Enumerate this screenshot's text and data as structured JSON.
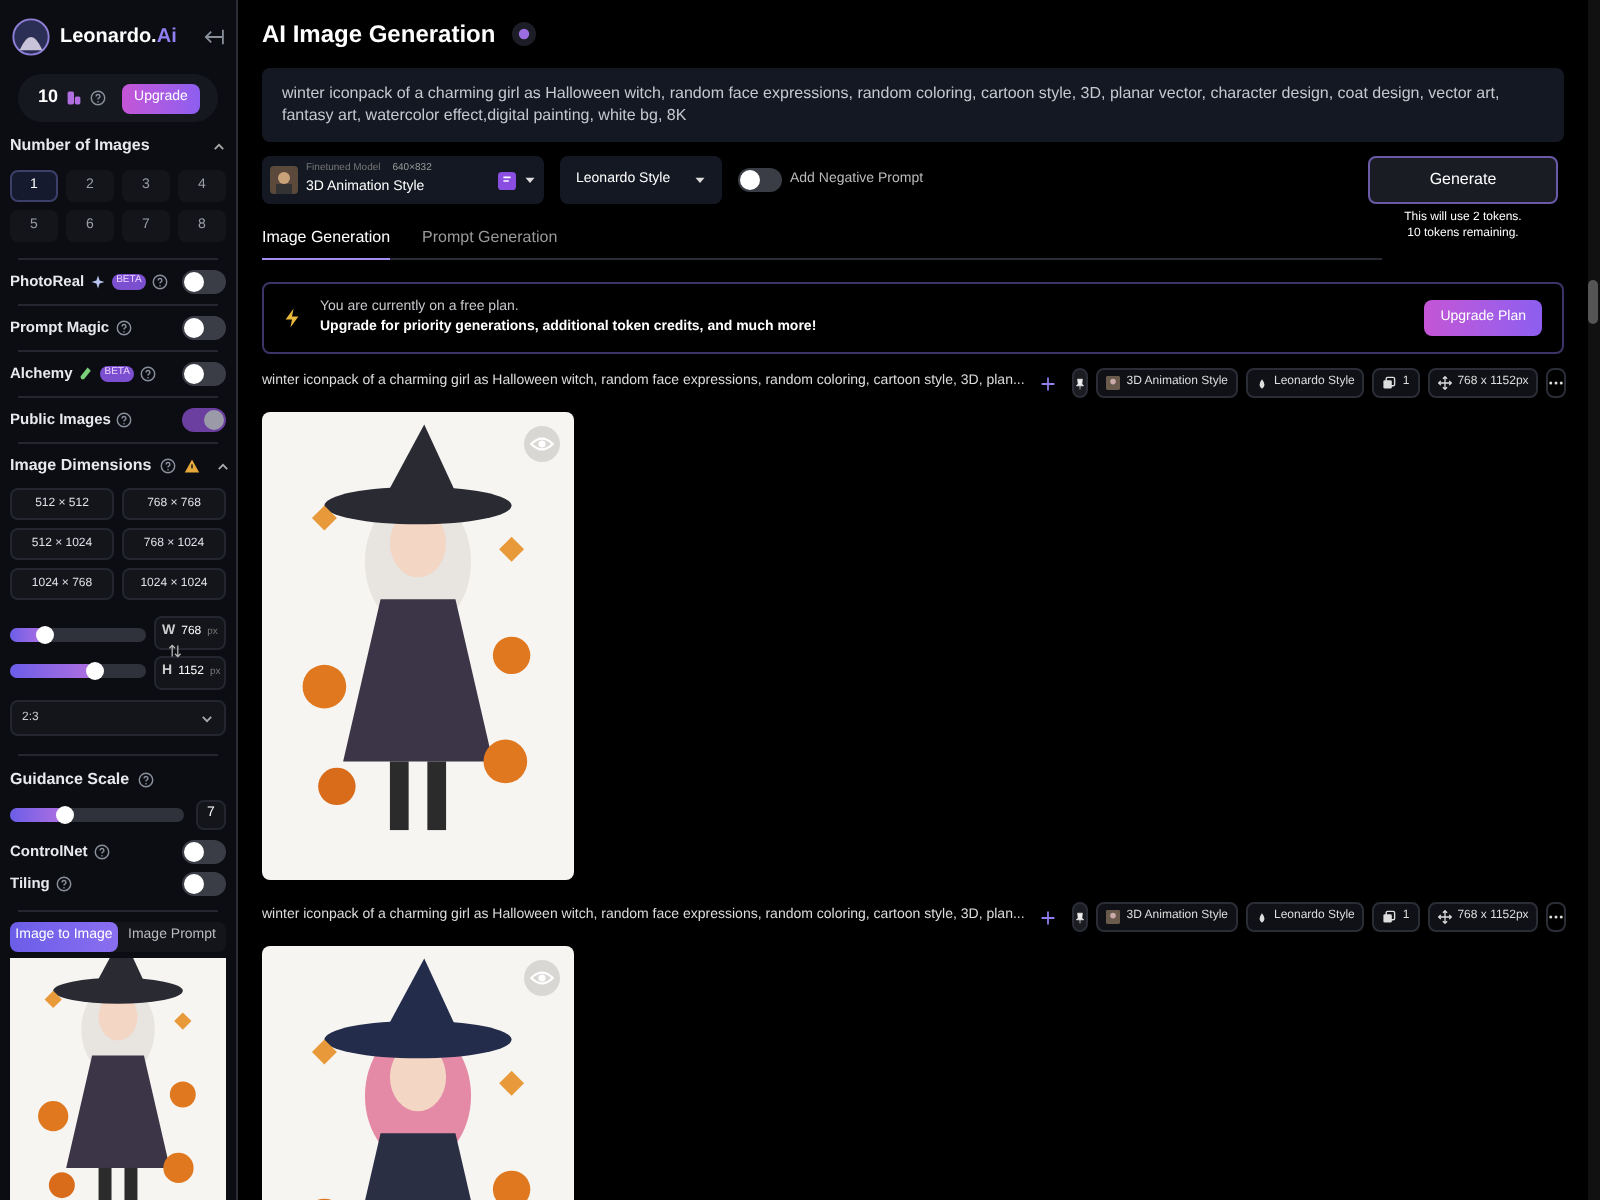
{
  "sidebar": {
    "brand": "Leonardo.",
    "brand_accent": "Ai",
    "tokens": "10",
    "upgrade": "Upgrade",
    "number_of_images": {
      "title": "Number of Images",
      "options": [
        {
          "label": "1",
          "selected": true
        },
        {
          "label": "2",
          "selected": false
        },
        {
          "label": "3",
          "selected": false
        },
        {
          "label": "4",
          "selected": false
        },
        {
          "label": "5",
          "selected": false
        },
        {
          "label": "6",
          "selected": false
        },
        {
          "label": "7",
          "selected": false
        },
        {
          "label": "8",
          "selected": false
        }
      ]
    },
    "toggles": [
      {
        "label": "PhotoReal",
        "kind": "sparkle",
        "badge": "BETA",
        "on": false
      },
      {
        "label": "Prompt Magic",
        "kind": "plain",
        "on": false
      },
      {
        "label": "Alchemy",
        "kind": "flask",
        "badge": "BETA",
        "on": false
      },
      {
        "label": "Public Images",
        "kind": "plain",
        "on": true
      }
    ],
    "dimensions": {
      "title": "Image Dimensions",
      "presets": [
        "512 × 512",
        "768 × 768",
        "512 × 1024",
        "768 × 1024",
        "1024 × 768",
        "1024 × 1024"
      ],
      "width": {
        "letter": "W",
        "value": "768",
        "unit": "px",
        "level": 0.25
      },
      "height": {
        "letter": "H",
        "value": "1152",
        "unit": "px",
        "level": 0.62
      },
      "aspect": "2:3"
    },
    "guidance": {
      "title": "Guidance Scale",
      "level": 0.31,
      "value": "7"
    },
    "toggles_2": [
      {
        "label": "ControlNet",
        "on": false
      },
      {
        "label": "Tiling",
        "on": false
      }
    ],
    "source_tabs": [
      {
        "label": "Image to Image",
        "selected": true
      },
      {
        "label": "Image Prompt",
        "selected": false
      }
    ]
  },
  "main": {
    "title": "AI Image Generation",
    "prompt": "winter iconpack of a charming girl as Halloween witch, random face expressions, random coloring, cartoon style, 3D, planar vector, character design, coat design, vector art, fantasy art, watercolor effect,digital painting, white bg, 8K",
    "model": {
      "caption": "Finetuned Model",
      "size": "640×832",
      "name": "3D Animation Style"
    },
    "style": "Leonardo Style",
    "negative_prompt": {
      "label": "Add Negative Prompt",
      "on": false
    },
    "generate": {
      "label": "Generate",
      "note": [
        "This will use 2 tokens.",
        "10 tokens remaining."
      ]
    },
    "tabs": [
      {
        "label": "Image Generation",
        "selected": true
      },
      {
        "label": "Prompt Generation",
        "selected": false
      }
    ],
    "banner": {
      "line_1": "You are currently on a free plan.",
      "line_2": "Upgrade for priority generations, additional token credits, and much more!",
      "button": "Upgrade Plan"
    },
    "generations": [
      {
        "prompt": "winter iconpack of a charming girl as Halloween witch, random face expressions, random coloring, cartoon style, 3D, plan...",
        "chips": [
          {
            "kind": "model",
            "label": "3D Animation Style"
          },
          {
            "kind": "style",
            "label": "Leonardo Style"
          },
          {
            "kind": "count",
            "label": "1"
          },
          {
            "kind": "size",
            "label": "768 x 1152px"
          }
        ]
      },
      {
        "prompt": "winter iconpack of a charming girl as Halloween witch, random face expressions, random coloring, cartoon style, 3D, plan...",
        "chips": [
          {
            "kind": "model",
            "label": "3D Animation Style"
          },
          {
            "kind": "style",
            "label": "Leonardo Style"
          },
          {
            "kind": "count",
            "label": "1"
          },
          {
            "kind": "size",
            "label": "768 x 1152px"
          }
        ]
      }
    ]
  }
}
